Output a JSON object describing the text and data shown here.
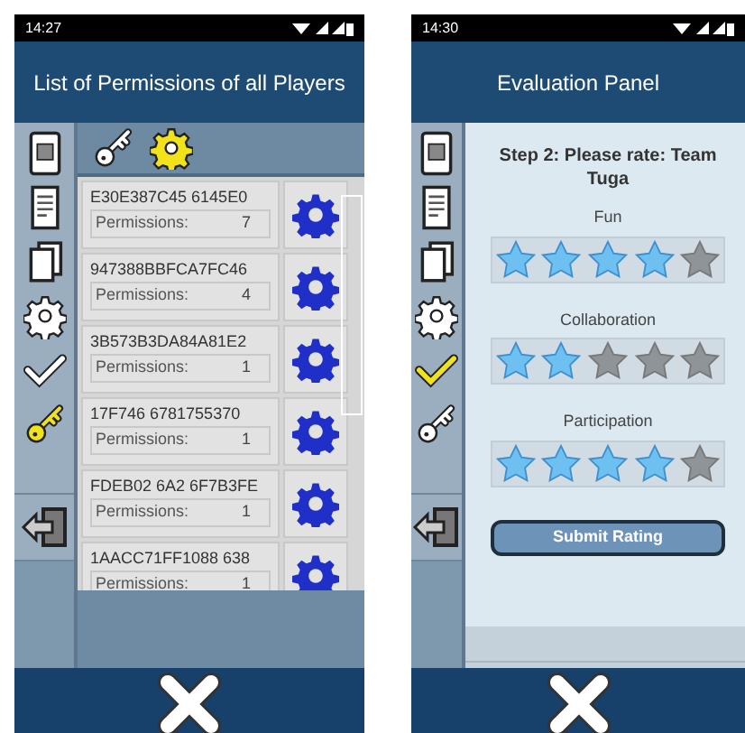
{
  "screens": [
    {
      "kind": "permissions",
      "status_bar": {
        "time": "14:27"
      },
      "title": "List of Permissions of all Players",
      "sidebar": [
        {
          "kind": "device",
          "selected": false
        },
        {
          "kind": "document",
          "selected": false
        },
        {
          "kind": "pages",
          "selected": false
        },
        {
          "kind": "gear",
          "selected": false
        },
        {
          "kind": "check",
          "selected": false
        },
        {
          "kind": "key",
          "selected": true
        }
      ],
      "tabs": [
        {
          "kind": "key",
          "selected": false
        },
        {
          "kind": "gear",
          "selected": true
        }
      ],
      "players": [
        {
          "id": "E30E387C45 6145E0",
          "permissions_label": "Permissions:",
          "permissions": "7"
        },
        {
          "id": "947388BBFCA7FC46",
          "permissions_label": "Permissions:",
          "permissions": "4"
        },
        {
          "id": "3B573B3DA84A81E2",
          "permissions_label": "Permissions:",
          "permissions": "1"
        },
        {
          "id": "17F746 6781755370",
          "permissions_label": "Permissions:",
          "permissions": "1"
        },
        {
          "id": "FDEB02 6A2 6F7B3FE",
          "permissions_label": "Permissions:",
          "permissions": "1"
        },
        {
          "id": "1AACC71FF1088 638",
          "permissions_label": "Permissions:",
          "permissions": "1"
        }
      ]
    },
    {
      "kind": "evaluation",
      "status_bar": {
        "time": "14:30"
      },
      "title": "Evaluation Panel",
      "sidebar": [
        {
          "kind": "device",
          "selected": false
        },
        {
          "kind": "document",
          "selected": false
        },
        {
          "kind": "pages",
          "selected": false
        },
        {
          "kind": "gear",
          "selected": false
        },
        {
          "kind": "check",
          "selected": true
        },
        {
          "kind": "key",
          "selected": false
        }
      ],
      "heading": "Step 2: Please rate: Team Tuga",
      "ratings": [
        {
          "label": "Fun",
          "stars": 4
        },
        {
          "label": "Collaboration",
          "stars": 2
        },
        {
          "label": "Participation",
          "stars": 4
        }
      ],
      "submit": "Submit Rating"
    }
  ]
}
